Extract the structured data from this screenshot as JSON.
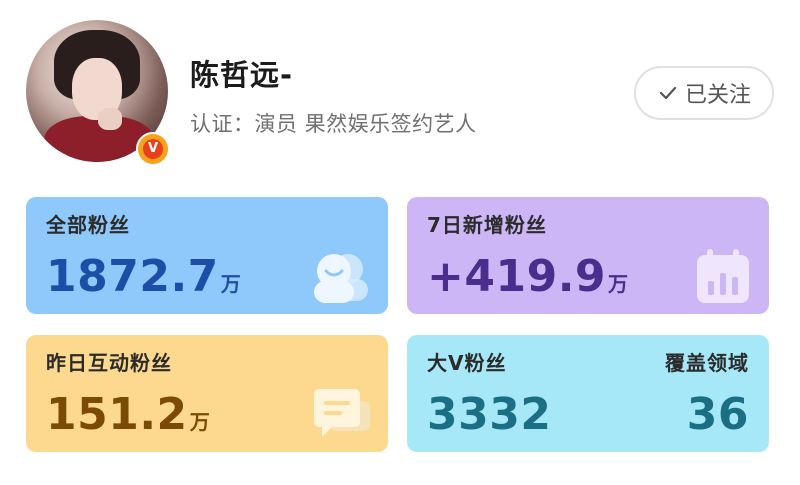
{
  "profile": {
    "name": "陈哲远-",
    "certification": "认证：演员 果然娱乐签约艺人",
    "follow_button_label": "已关注"
  },
  "stats": {
    "total_fans": {
      "label": "全部粉丝",
      "value": "1872.7",
      "unit": "万",
      "icon": "people-icon",
      "color": "#1a4fa8"
    },
    "new_fans_7d": {
      "label": "7日新增粉丝",
      "value": "+419.9",
      "unit": "万",
      "icon": "calendar-chart-icon",
      "color": "#4a2d8c"
    },
    "interactive_fans_yesterday": {
      "label": "昨日互动粉丝",
      "value": "151.2",
      "unit": "万",
      "icon": "chat-bubble-icon",
      "color": "#7a4a06"
    },
    "big_v_fans": {
      "label": "大V粉丝",
      "value": "3332",
      "color": "#1b6f85"
    },
    "covered_fields": {
      "label": "覆盖领域",
      "value": "36",
      "color": "#1b6f85"
    }
  },
  "colors": {
    "card_blue": "#8fc8fa",
    "card_purple": "#cdb6f5",
    "card_yellow": "#fcd98f",
    "card_cyan": "#a6e8f7"
  }
}
